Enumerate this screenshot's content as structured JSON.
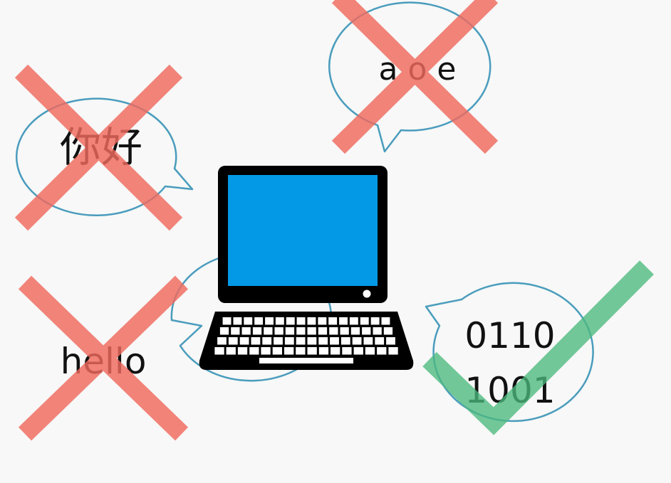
{
  "bubbles": {
    "chinese": {
      "text": "你好",
      "status": "rejected"
    },
    "pinyin": {
      "text": "a o e",
      "status": "rejected"
    },
    "english": {
      "text": "hello",
      "status": "rejected"
    },
    "binary": {
      "line1": "0110",
      "line2": "1001",
      "status": "accepted"
    }
  },
  "colors": {
    "bubble_outline": "#4a9cbd",
    "cross": "#f06a5e",
    "check": "#4cb97e",
    "screen": "#0399e6",
    "laptop": "#000000"
  },
  "icons": {
    "laptop": "laptop-icon",
    "cross": "cross-icon",
    "check": "check-icon"
  }
}
